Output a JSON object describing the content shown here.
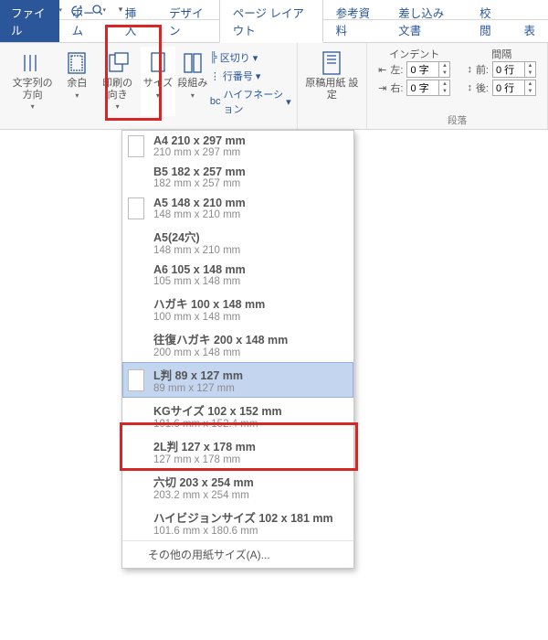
{
  "qat": {
    "save": "save-icon",
    "undo": "undo-icon",
    "redo": "redo-icon",
    "preview": "print-preview-icon"
  },
  "tabs": {
    "file": "ファイル",
    "home": "ホーム",
    "insert": "挿入",
    "design": "デザイン",
    "layout": "ページ レイアウト",
    "ref": "参考資料",
    "mail": "差し込み文書",
    "review": "校閲",
    "view": "表"
  },
  "ribbon": {
    "direction": "文字列の\n方向",
    "margins": "余白",
    "orient": "印刷の\n向き",
    "size": "サイズ",
    "columns": "段組み",
    "breaks": "区切り",
    "linenum": "行番号",
    "hyphen": "ハイフネーション",
    "manuscript": "原稿用紙\n設定",
    "indent_head": "インデント",
    "spacing_head": "間隔",
    "indent_left_lbl": "左:",
    "indent_left_val": "0 字",
    "indent_right_lbl": "右:",
    "indent_right_val": "0 字",
    "space_before_lbl": "前:",
    "space_before_val": "0 行",
    "space_after_lbl": "後:",
    "space_after_val": "0 行",
    "para_group": "段落"
  },
  "menu": {
    "items": [
      {
        "t1": "A4 210 x 297 mm",
        "t2": "210 mm x 297 mm",
        "thumb": true
      },
      {
        "t1": "B5 182 x 257 mm",
        "t2": "182 mm x 257 mm",
        "thumb": false
      },
      {
        "t1": "A5 148 x 210 mm",
        "t2": "148 mm x 210 mm",
        "thumb": true
      },
      {
        "t1": "A5(24穴)",
        "t2": "148 mm x 210 mm",
        "thumb": false
      },
      {
        "t1": "A6 105 x 148 mm",
        "t2": "105 mm x 148 mm",
        "thumb": false
      },
      {
        "t1": "ハガキ 100 x 148 mm",
        "t2": "100 mm x 148 mm",
        "thumb": false
      },
      {
        "t1": "往復ハガキ 200 x 148 mm",
        "t2": "200 mm x 148 mm",
        "thumb": false
      },
      {
        "t1": "L判 89 x 127 mm",
        "t2": "89 mm x 127 mm",
        "thumb": true,
        "sel": true
      },
      {
        "t1": "KGサイズ 102 x 152 mm",
        "t2": "101.6 mm x 152.4 mm",
        "thumb": false
      },
      {
        "t1": "2L判 127 x 178 mm",
        "t2": "127 mm x 178 mm",
        "thumb": false
      },
      {
        "t1": "六切 203 x 254 mm",
        "t2": "203.2 mm x 254 mm",
        "thumb": false
      },
      {
        "t1": "ハイビジョンサイズ 102 x 181 mm",
        "t2": "101.6 mm x 180.6 mm",
        "thumb": false
      }
    ],
    "more": "その他の用紙サイズ(A)..."
  }
}
